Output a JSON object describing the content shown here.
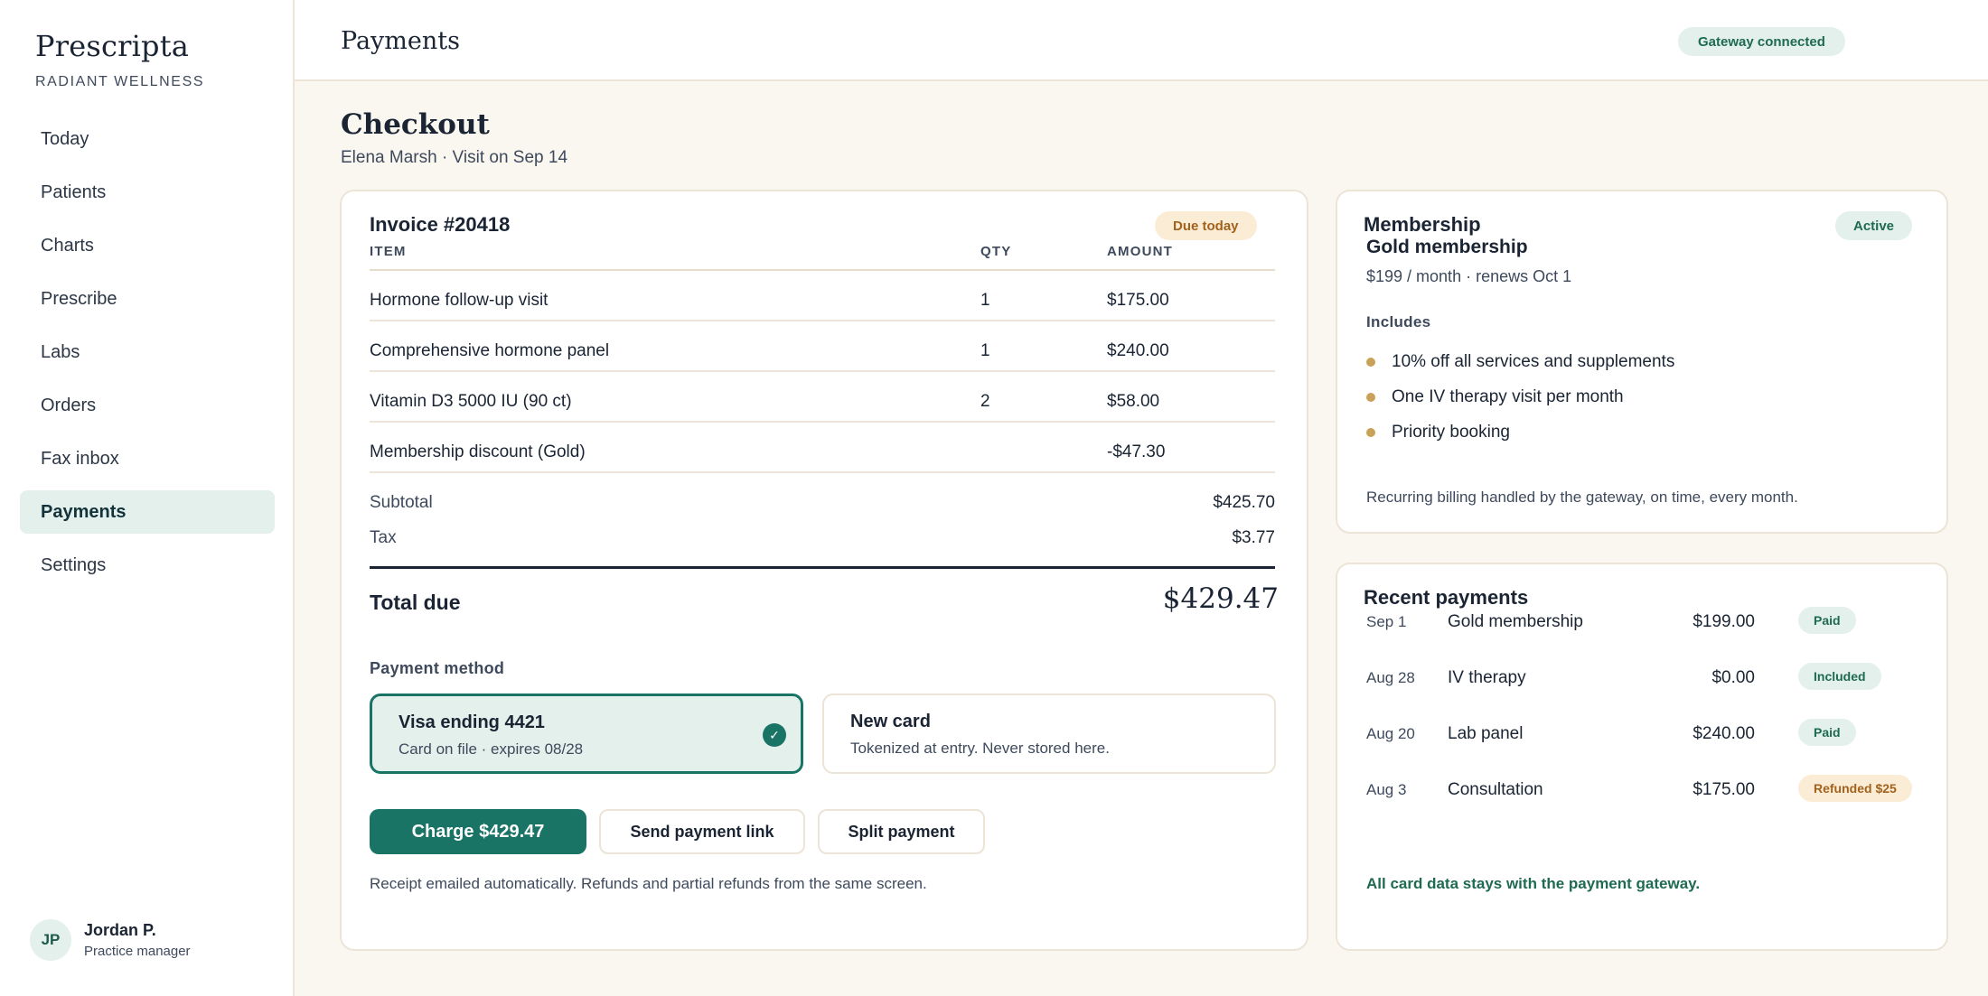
{
  "brand": {
    "name": "Prescripta",
    "subtitle": "RADIANT WELLNESS"
  },
  "sidebar": {
    "items": [
      {
        "label": "Today"
      },
      {
        "label": "Patients"
      },
      {
        "label": "Charts"
      },
      {
        "label": "Prescribe"
      },
      {
        "label": "Labs"
      },
      {
        "label": "Orders"
      },
      {
        "label": "Fax inbox"
      },
      {
        "label": "Payments",
        "active": true
      },
      {
        "label": "Settings"
      }
    ]
  },
  "user": {
    "initials": "JP",
    "name": "Jordan P.",
    "role": "Practice manager"
  },
  "topbar": {
    "title": "Payments",
    "status_badge": "Gateway connected"
  },
  "page": {
    "title": "Checkout",
    "subtitle": "Elena Marsh · Visit on Sep 14"
  },
  "invoice": {
    "title": "Invoice #20418",
    "status": "Due today",
    "columns": {
      "item": "ITEM",
      "qty": "QTY",
      "amount": "AMOUNT"
    },
    "rows": [
      {
        "item": "Hormone follow-up visit",
        "qty": "1",
        "amount": "$175.00"
      },
      {
        "item": "Comprehensive hormone panel",
        "qty": "1",
        "amount": "$240.00"
      },
      {
        "item": "Vitamin D3 5000 IU (90 ct)",
        "qty": "2",
        "amount": "$58.00"
      },
      {
        "item": "Membership discount (Gold)",
        "qty": "",
        "amount": "-$47.30"
      }
    ],
    "subtotal_label": "Subtotal",
    "subtotal": "$425.70",
    "tax_label": "Tax",
    "tax": "$3.77",
    "total_label": "Total due",
    "total": "$429.47",
    "payment_method_label": "Payment method",
    "methods": {
      "visa": {
        "title": "Visa ending 4421",
        "desc": "Card on file · expires 08/28",
        "check": "✓"
      },
      "new_card": {
        "title": "New card",
        "desc": "Tokenized at entry. Never stored here."
      }
    },
    "buttons": {
      "charge": "Charge $429.47",
      "send_link": "Send payment link",
      "split": "Split payment"
    },
    "receipt_note": "Receipt emailed automatically. Refunds and partial refunds from the same screen."
  },
  "membership": {
    "title": "Membership",
    "status": "Active",
    "plan": "Gold membership",
    "price": "$199 / month · renews Oct 1",
    "includes_label": "Includes",
    "benefits": [
      "10% off all services and supplements",
      "One IV therapy visit per month",
      "Priority booking"
    ],
    "note": "Recurring billing handled by the gateway, on time, every month."
  },
  "recent_payments": {
    "title": "Recent payments",
    "rows": [
      {
        "date": "Sep 1",
        "desc": "Gold membership",
        "amount": "$199.00",
        "status": "Paid"
      },
      {
        "date": "Aug 28",
        "desc": "IV therapy",
        "amount": "$0.00",
        "status": "Included"
      },
      {
        "date": "Aug 20",
        "desc": "Lab panel",
        "amount": "$240.00",
        "status": "Paid"
      },
      {
        "date": "Aug 3",
        "desc": "Consultation",
        "amount": "$175.00",
        "status": "Refunded $25"
      }
    ],
    "note": "All card data stays with the payment gateway."
  },
  "colors": {
    "accent": "#1a7466",
    "accent_light": "#e3f0ec",
    "warning_bg": "#fbecd6",
    "warning_text": "#a2621c",
    "bullet": "#c9a159",
    "border": "#ece4d6"
  }
}
